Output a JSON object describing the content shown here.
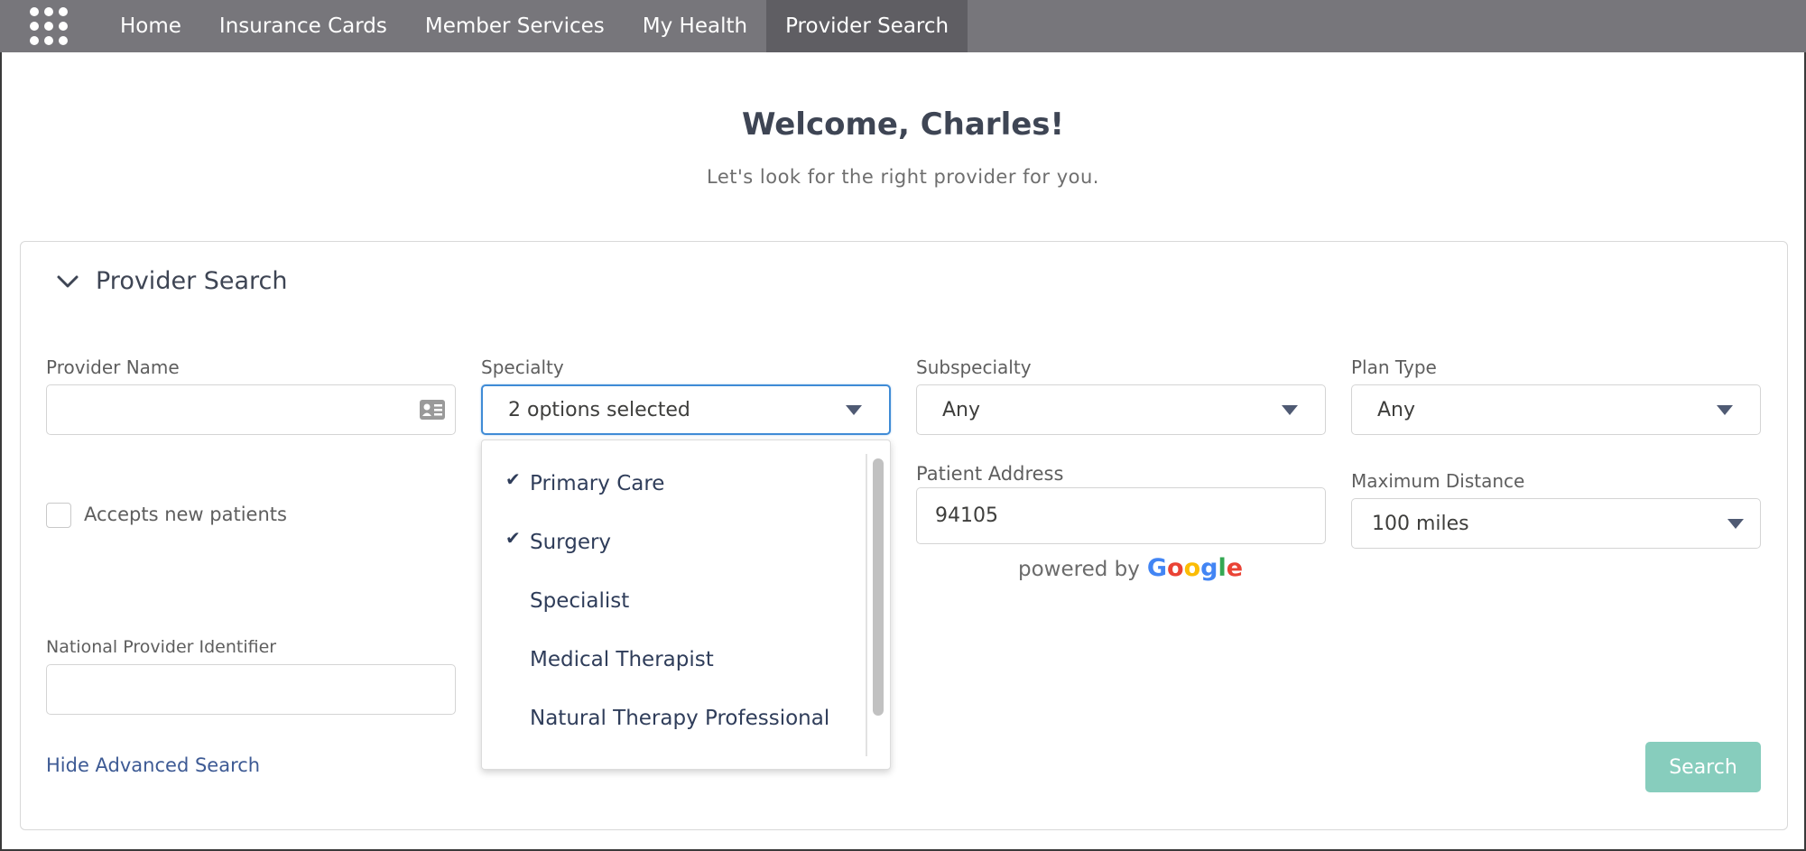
{
  "nav": {
    "items": [
      {
        "label": "Home"
      },
      {
        "label": "Insurance Cards"
      },
      {
        "label": "Member Services"
      },
      {
        "label": "My Health"
      },
      {
        "label": "Provider Search",
        "active": true
      }
    ]
  },
  "header": {
    "welcome": "Welcome, Charles!",
    "subtitle": "Let's look for the right provider for you."
  },
  "panel": {
    "title": "Provider Search",
    "expanded": true
  },
  "form": {
    "provider_name": {
      "label": "Provider Name",
      "value": ""
    },
    "specialty": {
      "label": "Specialty",
      "value": "2 options selected",
      "options": [
        {
          "label": "Primary Care",
          "selected": true
        },
        {
          "label": "Surgery",
          "selected": true
        },
        {
          "label": "Specialist",
          "selected": false
        },
        {
          "label": "Medical Therapist",
          "selected": false
        },
        {
          "label": "Natural Therapy Professional",
          "selected": false
        }
      ]
    },
    "subspecialty": {
      "label": "Subspecialty",
      "value": "Any"
    },
    "plan_type": {
      "label": "Plan Type",
      "value": "Any"
    },
    "accepts_new_patients": {
      "label": "Accepts new patients",
      "checked": false
    },
    "patient_address": {
      "label": "Patient Address",
      "value": "94105",
      "powered_by": "powered by",
      "google": [
        "G",
        "o",
        "o",
        "g",
        "l",
        "e"
      ]
    },
    "max_distance": {
      "label": "Maximum Distance",
      "value": "100 miles"
    },
    "npi": {
      "label": "National Provider Identifier",
      "value": ""
    }
  },
  "actions": {
    "hide_advanced": "Hide Advanced Search",
    "search": "Search"
  },
  "colors": {
    "nav_bg": "#77767b",
    "nav_active": "#5f5e63",
    "focus_border": "#3f8bd6",
    "search_button": "#87cdbd",
    "link": "#3d5a94"
  }
}
